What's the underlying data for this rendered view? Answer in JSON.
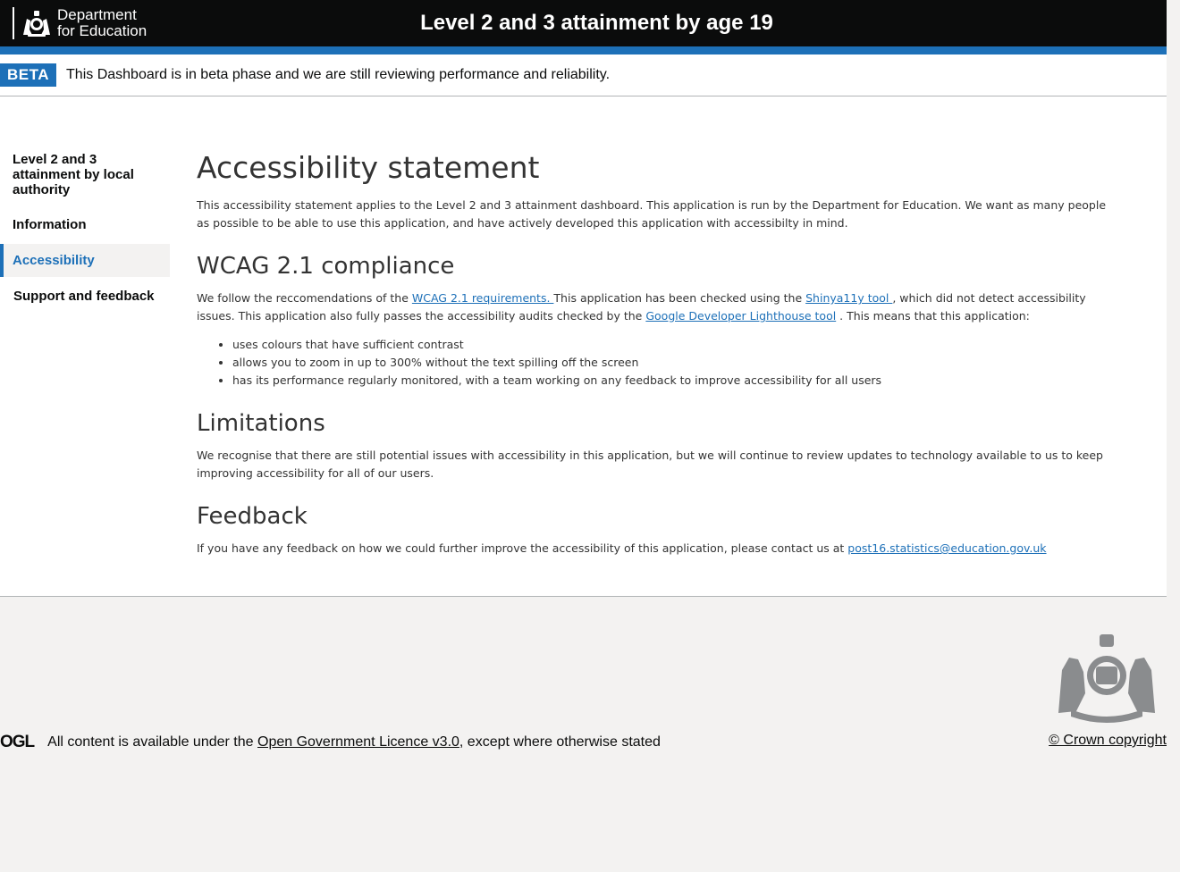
{
  "header": {
    "dept_line1": "Department",
    "dept_line2": "for Education",
    "title": "Level 2 and 3 attainment by age 19"
  },
  "beta": {
    "tag": "BETA",
    "text": "This Dashboard is in beta phase and we are still reviewing performance and reliability."
  },
  "sidebar": {
    "items": [
      {
        "label": "Level 2 and 3 attainment by local authority"
      },
      {
        "label": "Information"
      },
      {
        "label": "Accessibility",
        "active": true
      },
      {
        "label": "Support and feedback"
      }
    ]
  },
  "main": {
    "title": "Accessibility statement",
    "intro": "This accessibility statement applies to the Level 2 and 3 attainment dashboard. This application is run by the Department for Education. We want as many people as possible to be able to use this application, and have actively developed this application with accessibilty in mind.",
    "wcag": {
      "heading": "WCAG 2.1 compliance",
      "text1": "We follow the reccomendations of the ",
      "link1": "WCAG 2.1 requirements. ",
      "text2": "This application has been checked using the ",
      "link2": "Shinya11y tool ",
      "text3": ", which did not detect accessibility issues. This application also fully passes the accessibility audits checked by the ",
      "link3": "Google Developer Lighthouse tool",
      "text4": " . This means that this application:",
      "bullets": [
        "uses colours that have sufficient contrast",
        "allows you to zoom in up to 300% without the text spilling off the screen",
        "has its performance regularly monitored, with a team working on any feedback to improve accessibility for all users"
      ]
    },
    "limitations": {
      "heading": "Limitations",
      "text": "We recognise that there are still potential issues with accessibility in this application, but we will continue to review updates to technology available to us to keep improving accessibility for all of our users."
    },
    "feedback": {
      "heading": "Feedback",
      "text": "If you have any feedback on how we could further improve the accessibility of this application, please contact us at ",
      "email": "post16.statistics@education.gov.uk"
    }
  },
  "footer": {
    "ogl_logo": "OGL",
    "licence_prefix": "All content is available under the ",
    "licence_link": "Open Government Licence v3.0",
    "licence_suffix": " , except where otherwise stated",
    "crown": "© Crown copyright"
  },
  "colors": {
    "header_bg": "#0b0c0c",
    "accent_blue": "#1d70b8",
    "footer_bg": "#f3f2f1"
  }
}
